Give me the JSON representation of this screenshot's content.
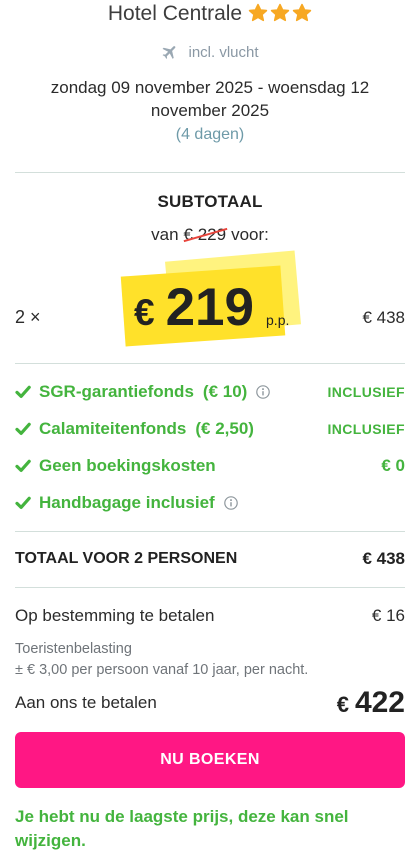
{
  "hotel": {
    "name": "Hotel Centrale",
    "stars": 3
  },
  "transport": {
    "icon": "plane-icon",
    "label": "incl. vlucht"
  },
  "stay": {
    "dates": "zondag 09 november 2025 - woensdag 12 november 2025",
    "duration": "(4 dagen)"
  },
  "subtotal": {
    "heading": "SUBTOTAAL",
    "was_prefix": "van",
    "was_price": "€ 229",
    "was_suffix": "voor:",
    "quantity": "2 ×",
    "currency": "€",
    "price_pp": "219",
    "per_person": "p.p.",
    "line_total": "€ 438"
  },
  "inclusions": [
    {
      "icon": "checkmark-icon",
      "label": "SGR-garantiefonds",
      "amount": "(€ 10)",
      "info_icon": "info-icon",
      "value": "INCLUSIEF"
    },
    {
      "icon": "checkmark-icon",
      "label": "Calamiteitenfonds",
      "amount": "(€ 2,50)",
      "value": "INCLUSIEF"
    },
    {
      "icon": "checkmark-icon",
      "label": "Geen boekingskosten",
      "value": "€ 0"
    },
    {
      "icon": "checkmark-icon",
      "label": "Handbagage inclusief",
      "info_icon": "info-icon"
    }
  ],
  "total": {
    "label": "TOTAAL VOOR 2 PERSONEN",
    "value": "€ 438"
  },
  "local_payment": {
    "label": "Op bestemming te betalen",
    "value": "€ 16",
    "note_title": "Toeristenbelasting",
    "note_text": "± € 3,00 per persoon vanaf 10 jaar, per nacht."
  },
  "pay_us": {
    "label": "Aan ons te betalen",
    "currency": "€",
    "amount": "422"
  },
  "cta": {
    "label": "NU BOEKEN"
  },
  "notice": "Je hebt nu de laagste prijs, deze kan snel wijzigen.",
  "colors": {
    "success_green": "#44b43e",
    "accent_pink": "#ff1784",
    "highlight_yellow": "#ffe12a",
    "highlight_pale_yellow": "#fff37f",
    "strike_red": "#e8453c",
    "star_orange": "#f7a823"
  }
}
